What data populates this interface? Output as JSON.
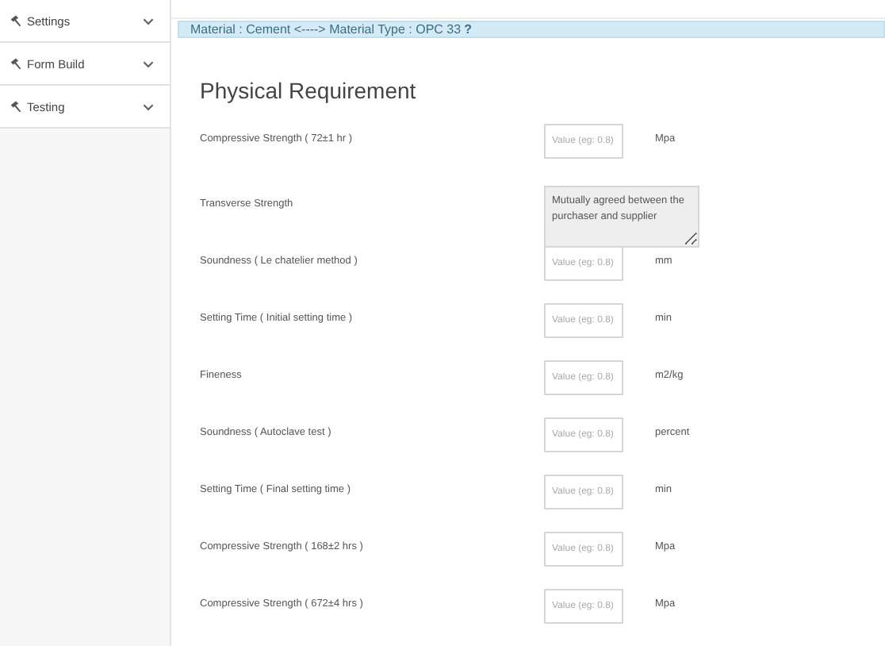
{
  "sidebar": {
    "items": [
      {
        "label": "Settings",
        "expanded": false
      },
      {
        "label": "Form Build",
        "expanded": false
      },
      {
        "label": "Testing",
        "expanded": false
      }
    ]
  },
  "banner": "Material : Cement <----> Material Type : OPC 33 **?**",
  "section_title": "Physical Requirement",
  "rows": [
    {
      "kind": "input",
      "label": "Compressive Strength ( 72±1 hr )",
      "placeholder": "Value (eg: 0.8)",
      "unit": "Mpa"
    },
    {
      "kind": "textarea",
      "label": "Transverse Strength",
      "value": "Mutually agreed between the purchaser and supplier",
      "disabled": true
    },
    {
      "kind": "input",
      "label": "Soundness ( Le chatelier method )",
      "placeholder": "Value (eg: 0.8)",
      "unit": "mm"
    },
    {
      "kind": "input",
      "label": "Setting Time ( Initial setting time )",
      "placeholder": "Value (eg: 0.8)",
      "unit": "min"
    },
    {
      "kind": "input",
      "label": "Fineness",
      "placeholder": "Value (eg: 0.8)",
      "unit": "m2/kg"
    },
    {
      "kind": "input",
      "label": "Soundness ( Autoclave test )",
      "placeholder": "Value (eg: 0.8)",
      "unit": "percent"
    },
    {
      "kind": "input",
      "label": "Setting Time ( Final setting time )",
      "placeholder": "Value (eg: 0.8)",
      "unit": "min"
    },
    {
      "kind": "input",
      "label": "Compressive Strength ( 168±2 hrs )",
      "placeholder": "Value (eg: 0.8)",
      "unit": "Mpa"
    },
    {
      "kind": "input",
      "label": "Compressive Strength ( 672±4 hrs )",
      "placeholder": "Value (eg: 0.8)",
      "unit": "Mpa"
    }
  ]
}
